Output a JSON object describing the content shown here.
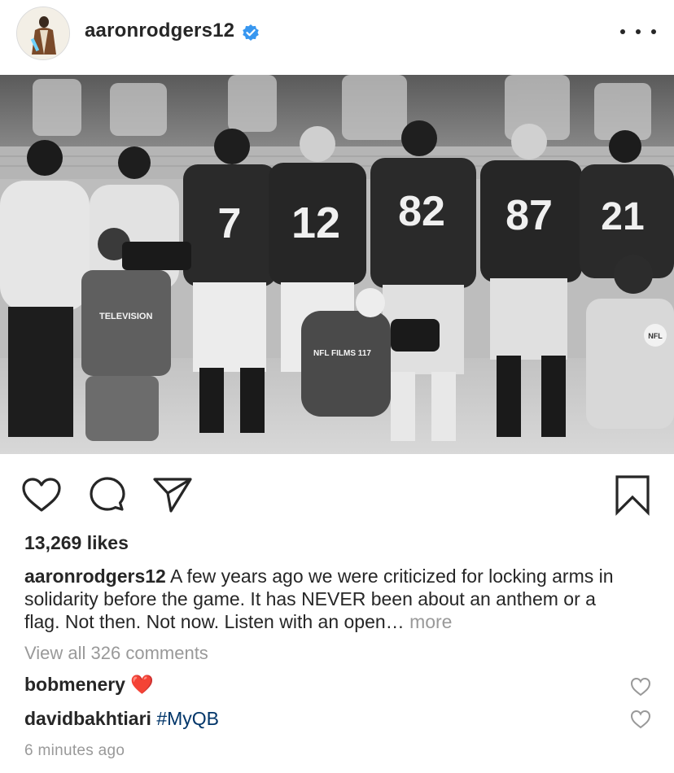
{
  "post": {
    "username": "aaronrodgers12",
    "verified": true,
    "photo": {
      "description_icon": "photo-image",
      "jerseys": [
        "7",
        "12",
        "82",
        "87",
        "21"
      ],
      "vest_text": "TELEVISION",
      "vest_text_2": "NFL FILMS 117",
      "badge_text": "NFL"
    }
  },
  "actions": {
    "like_icon": "heart-icon",
    "comment_icon": "comment-icon",
    "share_icon": "paper-plane-icon",
    "save_icon": "bookmark-icon"
  },
  "likes": "13,269 likes",
  "caption": {
    "username": "aaronrodgers12",
    "text": "A few years ago we were criticized for locking arms in solidarity before the game. It has NEVER been about an anthem or a flag. Not then. Not now. Listen with an open…",
    "more": "more"
  },
  "view_all": "View all 326 comments",
  "comments": [
    {
      "username": "bobmenery",
      "text": "",
      "emoji": "❤️"
    },
    {
      "username": "davidbakhtiari",
      "text": "#MyQB",
      "emoji": ""
    }
  ],
  "timestamp": "6 minutes ago",
  "colors": {
    "text": "#262626",
    "muted": "#999999",
    "hashtag": "#003569",
    "verified": "#3897f0",
    "heart": "#ed4956"
  }
}
